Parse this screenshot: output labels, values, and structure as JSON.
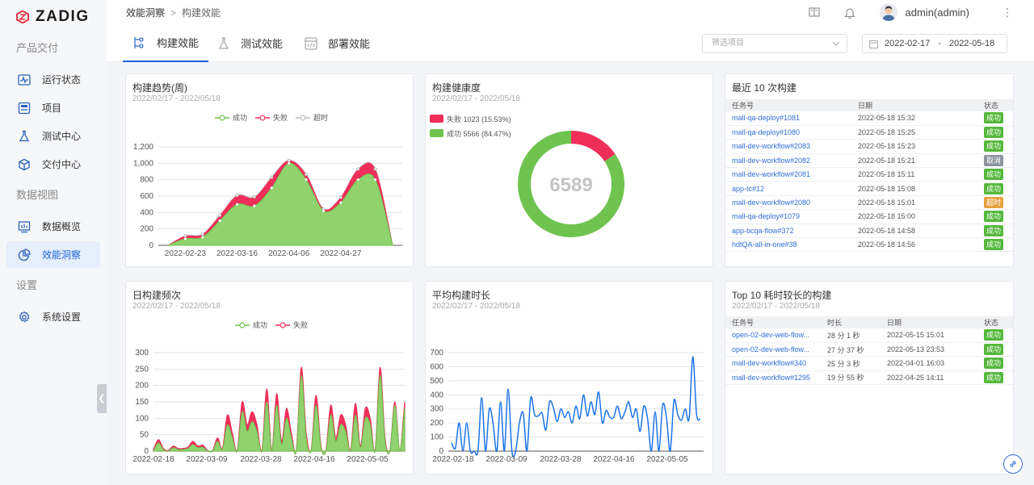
{
  "brand": {
    "name": "ZADIG"
  },
  "sidebar": {
    "sections": [
      {
        "title": "产品交付",
        "items": [
          {
            "label": "运行状态",
            "icon": "pulse-icon"
          },
          {
            "label": "项目",
            "icon": "project-icon"
          },
          {
            "label": "测试中心",
            "icon": "flask-icon"
          },
          {
            "label": "交付中心",
            "icon": "cube-icon"
          }
        ]
      },
      {
        "title": "数据视图",
        "items": [
          {
            "label": "数据概览",
            "icon": "bar-chart-icon"
          },
          {
            "label": "效能洞察",
            "icon": "pie-chart-icon",
            "active": true
          }
        ]
      },
      {
        "title": "设置",
        "items": [
          {
            "label": "系统设置",
            "icon": "gear-icon"
          }
        ]
      }
    ]
  },
  "header": {
    "breadcrumb": [
      "效能洞察",
      "构建效能"
    ],
    "user": "admin(admin)"
  },
  "tabs": [
    {
      "label": "构建效能",
      "icon": "build-icon",
      "active": true
    },
    {
      "label": "测试效能",
      "icon": "flask-icon"
    },
    {
      "label": "部署效能",
      "icon": "deploy-icon"
    }
  ],
  "filters": {
    "project_placeholder": "筛选项目",
    "date_start": "2022-02-17",
    "date_separator": "-",
    "date_end": "2022-05-18"
  },
  "cards": {
    "trend": {
      "title": "构建趋势(周)",
      "subtitle": "2022/02/17 - 2022/05/18"
    },
    "health": {
      "title": "构建健康度",
      "subtitle": "2022/02/17 - 2022/05/18"
    },
    "recent": {
      "title": "最近 10 次构建"
    },
    "daily": {
      "title": "日构建频次",
      "subtitle": "2022/02/17 - 2022/05/18"
    },
    "avgdur": {
      "title": "平均构建时长",
      "subtitle": "2022/02/17 - 2022/05/18"
    },
    "top10": {
      "title": "Top 10 耗时较长的构建",
      "subtitle": "2022/02/17 - 2022/05/18"
    }
  },
  "chart_data": [
    {
      "id": "trend",
      "type": "area",
      "title": "构建趋势(周)",
      "x": [
        "2022-02-17",
        "2022-02-23",
        "2022-03-02",
        "2022-03-09",
        "2022-03-16",
        "2022-03-23",
        "2022-03-30",
        "2022-04-06",
        "2022-04-13",
        "2022-04-20",
        "2022-04-27",
        "2022-05-04",
        "2022-05-11",
        "2022-05-18"
      ],
      "xticks": [
        "2022-02-23",
        "2022-03-16",
        "2022-04-06",
        "2022-04-27"
      ],
      "yticks": [
        "0",
        "200",
        "400",
        "600",
        "800",
        "1,000",
        "1,200"
      ],
      "ylim": [
        0,
        1200
      ],
      "series": [
        {
          "name": "成功",
          "color": "#6fc34e",
          "values": [
            0,
            80,
            100,
            300,
            500,
            480,
            700,
            1000,
            800,
            420,
            520,
            800,
            800,
            0
          ]
        },
        {
          "name": "失败",
          "color": "#ef2f5a",
          "values": [
            0,
            30,
            30,
            60,
            100,
            100,
            120,
            30,
            60,
            20,
            60,
            120,
            120,
            0
          ]
        },
        {
          "name": "超时",
          "color": "#cccccc",
          "values": [
            0,
            5,
            5,
            5,
            10,
            10,
            10,
            5,
            5,
            5,
            5,
            10,
            10,
            0
          ]
        }
      ]
    },
    {
      "id": "health",
      "type": "pie",
      "title": "构建健康度",
      "total": "6589",
      "slices": [
        {
          "name": "失败",
          "value": 1023,
          "percent": "15.53%",
          "color": "#ef2f5a",
          "label": "失败 1023 (15.53%)"
        },
        {
          "name": "成功",
          "value": 5566,
          "percent": "84.47%",
          "color": "#6fc34e",
          "label": "成功 5566 (84.47%)"
        }
      ]
    },
    {
      "id": "daily",
      "type": "area",
      "title": "日构建频次",
      "xticks": [
        "2022-02-18",
        "2022-03-09",
        "2022-03-28",
        "2022-04-16",
        "2022-05-05"
      ],
      "yticks": [
        "0",
        "50",
        "100",
        "150",
        "200",
        "250",
        "300"
      ],
      "ylim": [
        0,
        300
      ],
      "series": [
        {
          "name": "成功",
          "color": "#6fc34e"
        },
        {
          "name": "失败",
          "color": "#ef2f5a"
        }
      ],
      "success": [
        0,
        25,
        5,
        0,
        10,
        5,
        5,
        8,
        20,
        10,
        12,
        0,
        0,
        30,
        5,
        80,
        40,
        0,
        120,
        60,
        90,
        60,
        0,
        150,
        0,
        140,
        20,
        100,
        40,
        0,
        230,
        40,
        0,
        140,
        10,
        0,
        110,
        30,
        80,
        60,
        0,
        110,
        10,
        100,
        80,
        0,
        230,
        30,
        0,
        140,
        0,
        130
      ],
      "failure": [
        5,
        35,
        8,
        2,
        15,
        8,
        8,
        12,
        30,
        15,
        18,
        2,
        2,
        40,
        8,
        110,
        55,
        2,
        150,
        80,
        120,
        80,
        2,
        190,
        2,
        175,
        30,
        130,
        55,
        2,
        255,
        55,
        2,
        170,
        15,
        2,
        140,
        40,
        110,
        80,
        2,
        145,
        15,
        130,
        100,
        2,
        255,
        40,
        2,
        150,
        2,
        150
      ]
    },
    {
      "id": "avgdur",
      "type": "line",
      "title": "平均构建时长",
      "xticks": [
        "2022-02-18",
        "2022-03-09",
        "2022-03-28",
        "2022-04-16",
        "2022-05-05"
      ],
      "yticks": [
        "0",
        "100",
        "200",
        "300",
        "400",
        "500",
        "600",
        "700"
      ],
      "ylim": [
        0,
        700
      ],
      "series": [
        {
          "name": "",
          "color": "#1a74e8",
          "values": [
            60,
            20,
            200,
            0,
            200,
            0,
            0,
            0,
            380,
            0,
            300,
            200,
            0,
            350,
            0,
            440,
            0,
            0,
            200,
            270,
            0,
            380,
            260,
            250,
            270,
            150,
            350,
            310,
            210,
            300,
            240,
            280,
            200,
            320,
            230,
            400,
            250,
            350,
            260,
            420,
            200,
            290,
            240,
            240,
            320,
            230,
            280,
            350,
            240,
            300,
            140,
            320,
            230,
            0,
            280,
            0,
            330,
            240,
            0,
            360,
            260,
            220,
            300,
            230,
            670,
            260,
            230
          ]
        }
      ]
    }
  ],
  "recent_builds": {
    "headers": [
      "任务号",
      "日期",
      "状态"
    ],
    "rows": [
      {
        "task": "mall-qa-deploy#1081",
        "date": "2022-05-18 15:32",
        "status": "成功",
        "type": "success"
      },
      {
        "task": "mall-qa-deploy#1080",
        "date": "2022-05-18 15:25",
        "status": "成功",
        "type": "success"
      },
      {
        "task": "mall-dev-workflow#2083",
        "date": "2022-05-18 15:23",
        "status": "成功",
        "type": "success"
      },
      {
        "task": "mall-dev-workflow#2082",
        "date": "2022-05-18 15:21",
        "status": "取消",
        "type": "cancel"
      },
      {
        "task": "mall-dev-workflow#2081",
        "date": "2022-05-18 15:11",
        "status": "成功",
        "type": "success"
      },
      {
        "task": "app-tc#12",
        "date": "2022-05-18 15:08",
        "status": "成功",
        "type": "success"
      },
      {
        "task": "mall-dev-workflow#2080",
        "date": "2022-05-18 15:01",
        "status": "超时",
        "type": "timeout"
      },
      {
        "task": "mall-qa-deploy#1079",
        "date": "2022-05-18 15:00",
        "status": "成功",
        "type": "success"
      },
      {
        "task": "app-bcqa-flow#372",
        "date": "2022-05-18 14:58",
        "status": "成功",
        "type": "success"
      },
      {
        "task": "hdtQA-all-in-one#38",
        "date": "2022-05-18 14:56",
        "status": "成功",
        "type": "success"
      }
    ]
  },
  "top10": {
    "headers": [
      "任务号",
      "时长",
      "日期",
      "状态"
    ],
    "rows": [
      {
        "task": "open-02-dev-web-flow...",
        "duration": "28 分 1 秒",
        "date": "2022-05-15 15:01",
        "status": "成功"
      },
      {
        "task": "open-02-dev-web-flow...",
        "duration": "27 分 37 秒",
        "date": "2022-05-13 23:53",
        "status": "成功"
      },
      {
        "task": "mall-dev-workflow#340",
        "duration": "25 分 3 秒",
        "date": "2022-04-01 16:03",
        "status": "成功"
      },
      {
        "task": "mall-dev-workflow#1295",
        "duration": "19 分 55 秒",
        "date": "2022-04-25 14:11",
        "status": "成功"
      }
    ]
  }
}
